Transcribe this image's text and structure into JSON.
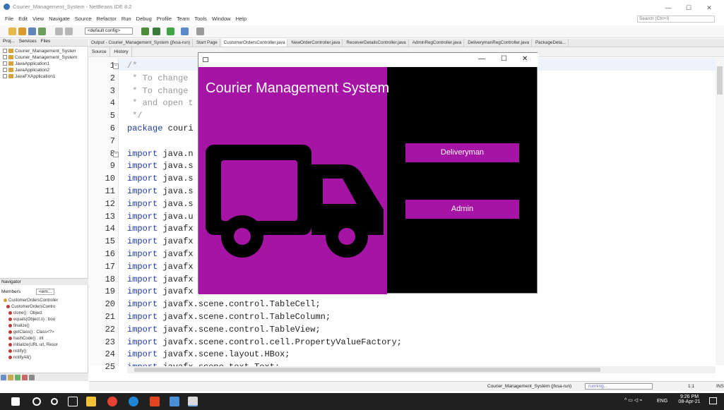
{
  "window": {
    "title": "Courier_Management_System - NetBeans IDE 8.2",
    "controls": [
      "—",
      "☐",
      "✕"
    ]
  },
  "menu": [
    "File",
    "Edit",
    "View",
    "Navigate",
    "Source",
    "Refactor",
    "Run",
    "Debug",
    "Profile",
    "Team",
    "Tools",
    "Window",
    "Help"
  ],
  "search": {
    "placeholder": "Search (Ctrl+I)"
  },
  "toolbar": {
    "config": "<default config>"
  },
  "projects": {
    "tabs": [
      "Proj...",
      "Services",
      "Files"
    ],
    "items": [
      "Courier_Management_Systen",
      "Courier_Management_System",
      "JavaApplication1",
      "JavaApplication2",
      "JavaFXApplication1"
    ]
  },
  "navigator": {
    "title": "Navigator",
    "members_label": "Members",
    "filter": "<em...",
    "items": [
      "CustomerOrdersController",
      "CustomerOrdersContro",
      "clone() : Object",
      "equals(Object o) : boo",
      "finalize()",
      "getClass() : Class<?>",
      "hashCode() : int",
      "initialize(URL url, Resor",
      "notify()",
      "notifyAll()"
    ]
  },
  "editor": {
    "output_tab": "Output - Courier_Management_System (jfxsa-run)",
    "tabs": [
      "Start Page",
      "CustomerOrdersController.java",
      "NewOrderController.java",
      "ReceiverDetailsController.java",
      "AdminRegController.java",
      "DeliverymanRegController.java",
      "PackageDeta..."
    ],
    "source_tabs": [
      "Source",
      "History"
    ],
    "lines": [
      {
        "n": "1",
        "t": "/*",
        "c": "cm"
      },
      {
        "n": "2",
        "t": " * To change",
        "c": "cm"
      },
      {
        "n": "3",
        "t": " * To change",
        "c": "cm"
      },
      {
        "n": "4",
        "t": " * and open t",
        "c": "cm"
      },
      {
        "n": "5",
        "t": " */",
        "c": "cm"
      },
      {
        "n": "6",
        "k": "package",
        "t": " couri"
      },
      {
        "n": "7",
        "t": ""
      },
      {
        "n": "8",
        "k": "import",
        "t": " java.n"
      },
      {
        "n": "9",
        "k": "import",
        "t": " java.s"
      },
      {
        "n": "10",
        "k": "import",
        "t": " java.s"
      },
      {
        "n": "11",
        "k": "import",
        "t": " java.s"
      },
      {
        "n": "12",
        "k": "import",
        "t": " java.s"
      },
      {
        "n": "13",
        "k": "import",
        "t": " java.u"
      },
      {
        "n": "14",
        "k": "import",
        "t": " javafx"
      },
      {
        "n": "15",
        "k": "import",
        "t": " javafx"
      },
      {
        "n": "16",
        "k": "import",
        "t": " javafx"
      },
      {
        "n": "17",
        "k": "import",
        "t": " javafx"
      },
      {
        "n": "18",
        "k": "import",
        "t": " javafx"
      },
      {
        "n": "19",
        "k": "import",
        "t": " javafx"
      },
      {
        "n": "20",
        "k": "import",
        "t": " javafx.scene.control.TableCell;"
      },
      {
        "n": "21",
        "k": "import",
        "t": " javafx.scene.control.TableColumn;"
      },
      {
        "n": "22",
        "k": "import",
        "t": " javafx.scene.control.TableView;"
      },
      {
        "n": "23",
        "k": "import",
        "t": " javafx.scene.control.cell.PropertyValueFactory;"
      },
      {
        "n": "24",
        "k": "import",
        "t": " javafx.scene.layout.HBox;"
      },
      {
        "n": "25",
        "k": "import",
        "t": " javafx.scene.text.Text;"
      }
    ]
  },
  "status": {
    "task": "Courier_Management_System (jfxsa-run)",
    "progress": "running...",
    "position": "1:1",
    "mode": "INS"
  },
  "taskbar": {
    "time": "9:26 PM",
    "date": "08-Apr-21",
    "lang": "ENG"
  },
  "fx_window": {
    "title": "Courier Management System",
    "buttons": [
      "Deliveryman",
      "Admin"
    ],
    "colors": {
      "purple": "#a614a6",
      "black": "#000000"
    }
  }
}
